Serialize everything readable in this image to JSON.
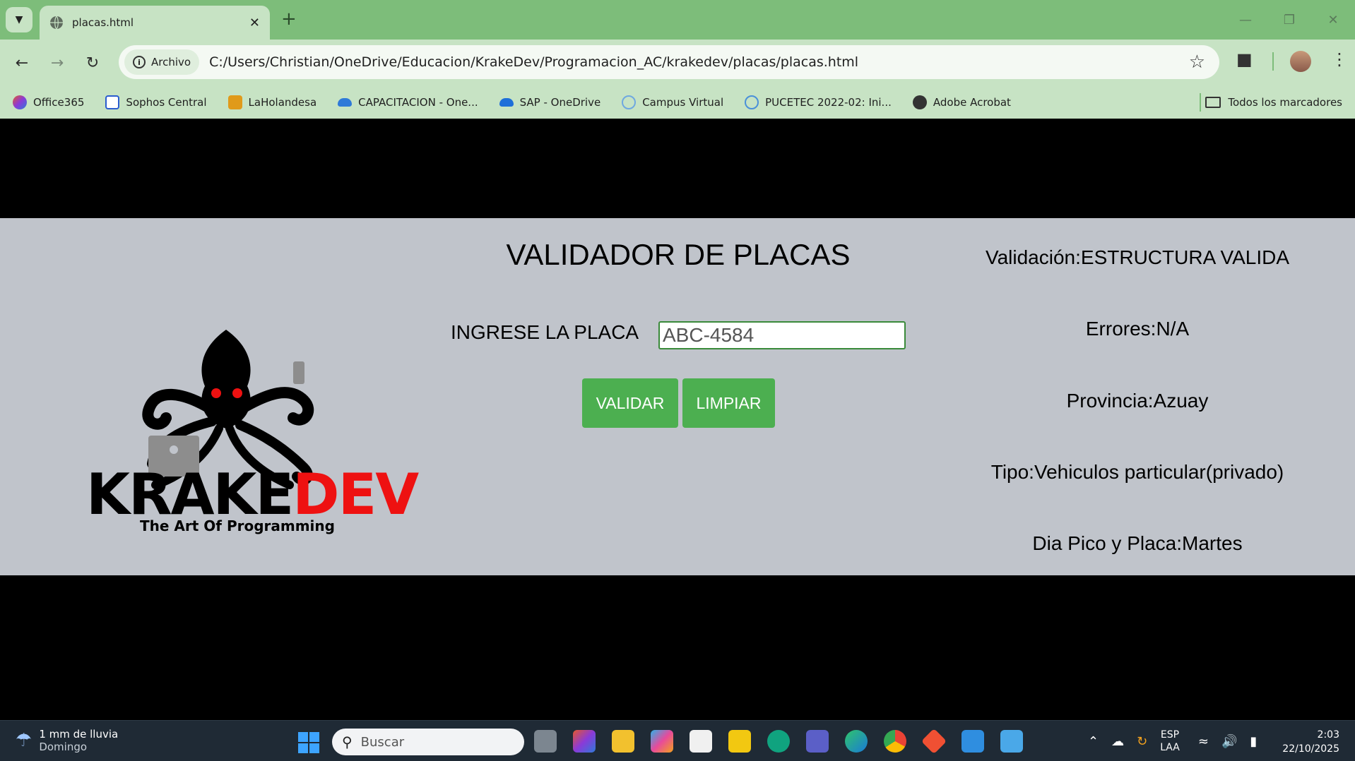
{
  "browser": {
    "tab_title": "placas.html",
    "address_chip": "Archivo",
    "url": "C:/Users/Christian/OneDrive/Educacion/KrakeDev/Programacion_AC/krakedev/placas/placas.html",
    "bookmarks": [
      {
        "label": "Office365",
        "color": "#e5572b"
      },
      {
        "label": "Sophos Central",
        "color": "#2a5ccf"
      },
      {
        "label": "LaHolandesa",
        "color": "#e09a1a"
      },
      {
        "label": "CAPACITACION - One...",
        "color": "#2f7ad8"
      },
      {
        "label": "SAP - OneDrive",
        "color": "#1e6fd9"
      },
      {
        "label": "Campus Virtual",
        "color": "#6fa8e0"
      },
      {
        "label": "PUCETEC 2022-02: Ini...",
        "color": "#4a90d9"
      },
      {
        "label": "Adobe Acrobat",
        "color": "#333333"
      }
    ],
    "all_bookmarks": "Todos los marcadores"
  },
  "page": {
    "logo_main": "KRAKE",
    "logo_accent": "DEV",
    "logo_tagline": "The Art Of Programming",
    "title": "VALIDADOR DE PLACAS",
    "input_label": "INGRESE LA PLACA",
    "input_value": "ABC-4584",
    "validate_button": "VALIDAR",
    "clear_button": "LIMPIAR",
    "results": {
      "validation": "Validación:ESTRUCTURA VALIDA",
      "errors": "Errores:N/A",
      "province": "Provincia:Azuay",
      "type": "Tipo:Vehiculos particular(privado)",
      "pico_placa": "Dia Pico y Placa:Martes"
    },
    "accent_color": "#4caf50"
  },
  "taskbar": {
    "weather_line1": "1 mm de lluvia",
    "weather_line2": "Domingo",
    "search_placeholder": "Buscar",
    "language_line1": "ESP",
    "language_line2": "LAA",
    "time": "2:03",
    "date": "22/10/2025"
  }
}
